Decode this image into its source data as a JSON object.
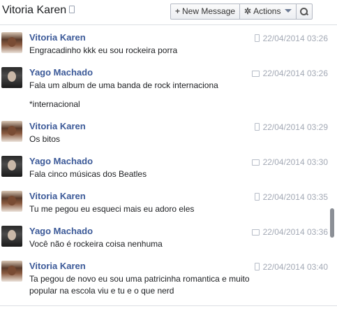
{
  "header": {
    "title": "Vitoria Karen",
    "new_message_label": "New Message",
    "actions_label": "Actions"
  },
  "messages": [
    {
      "author": "Vitoria Karen",
      "time": "22/04/2014 03:26",
      "device": "mobile-icon",
      "lines": [
        "Engracadinho kkk eu sou rockeira porra"
      ]
    },
    {
      "author": "Yago Machado",
      "time": "22/04/2014 03:26",
      "device": "chat-icon",
      "lines": [
        "Fala um album de uma banda de rock internaciona",
        "*internacional"
      ]
    },
    {
      "author": "Vitoria Karen",
      "time": "22/04/2014 03:29",
      "device": "mobile-icon",
      "lines": [
        "Os bitos"
      ]
    },
    {
      "author": "Yago Machado",
      "time": "22/04/2014 03:30",
      "device": "chat-icon",
      "lines": [
        "Fala cinco músicas dos Beatles"
      ]
    },
    {
      "author": "Vitoria Karen",
      "time": "22/04/2014 03:35",
      "device": "mobile-icon",
      "lines": [
        "Tu me pegou eu esqueci mais eu adoro eles"
      ]
    },
    {
      "author": "Yago Machado",
      "time": "22/04/2014 03:36",
      "device": "chat-icon",
      "lines": [
        "Você não é rockeira coisa nenhuma"
      ]
    },
    {
      "author": "Vitoria Karen",
      "time": "22/04/2014 03:40",
      "device": "mobile-icon",
      "lines": [
        "Ta pegou de novo eu sou uma patricinha romantica e muito",
        "popular na escola viu e tu e o que nerd"
      ]
    }
  ]
}
